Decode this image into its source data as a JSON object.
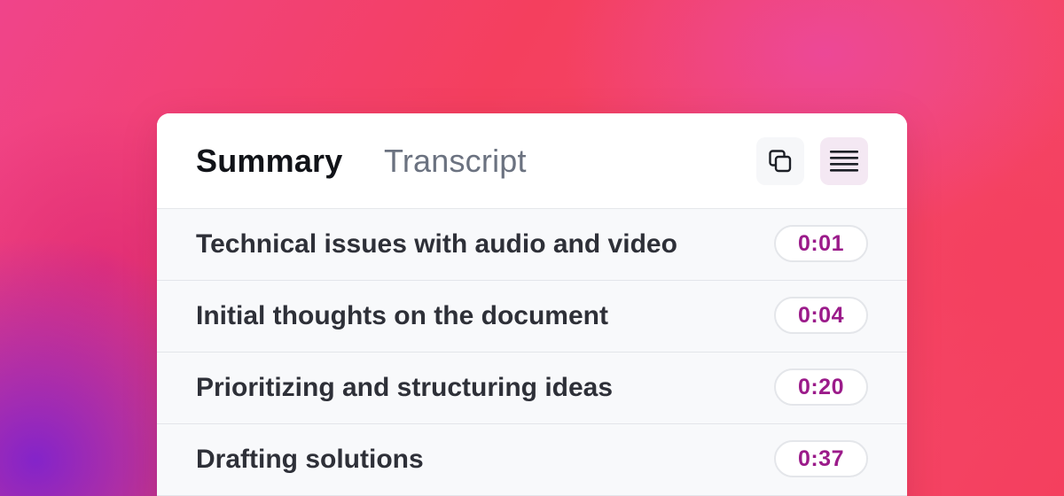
{
  "colors": {
    "accent": "#9b1b8a",
    "active_tab_text": "#111318",
    "inactive_tab_text": "#6b7280",
    "row_text": "#2e3038",
    "list_button_bg": "#f4e8f3"
  },
  "tabs": [
    {
      "label": "Summary",
      "active": true
    },
    {
      "label": "Transcript",
      "active": false
    }
  ],
  "toolbar": {
    "copy_icon": "copy-icon",
    "list_icon": "list-icon"
  },
  "summary_items": [
    {
      "title": "Technical issues with audio and video",
      "time": "0:01"
    },
    {
      "title": "Initial thoughts on the document",
      "time": "0:04"
    },
    {
      "title": "Prioritizing and structuring ideas",
      "time": "0:20"
    },
    {
      "title": "Drafting solutions",
      "time": "0:37"
    }
  ]
}
